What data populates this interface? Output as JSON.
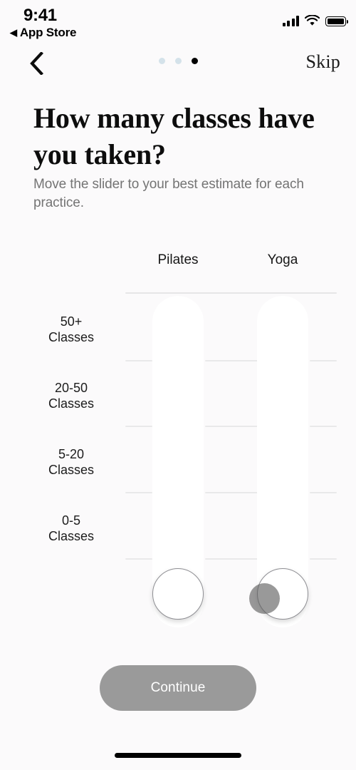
{
  "status_bar": {
    "time": "9:41",
    "return_app": "App Store",
    "return_arrow": "◀",
    "signal_icon": "cellular-signal-icon",
    "wifi_icon": "wifi-icon",
    "battery_icon": "battery-full-icon"
  },
  "nav": {
    "back_icon": "chevron-left-icon",
    "skip_label": "Skip",
    "dots": [
      {
        "active": false
      },
      {
        "active": false
      },
      {
        "active": true
      }
    ]
  },
  "content": {
    "headline": "How many classes have you taken?",
    "subtitle": "Move the slider to your best estimate for each practice."
  },
  "slider_chart": {
    "columns": [
      {
        "label": "Pilates",
        "value_index": 0,
        "value_label": "0-5 Classes"
      },
      {
        "label": "Yoga",
        "value_index": 0,
        "value_label": "0-5 Classes"
      }
    ],
    "axis_labels": [
      {
        "line1": "50+",
        "line2": "Classes"
      },
      {
        "line1": "20-50",
        "line2": "Classes"
      },
      {
        "line1": "5-20",
        "line2": "Classes"
      },
      {
        "line1": "0-5",
        "line2": "Classes"
      }
    ],
    "touch_cursor": "touch-indicator"
  },
  "footer": {
    "continue_label": "Continue"
  },
  "colors": {
    "background": "#fbfafb",
    "track": "#ffffff",
    "gridline": "#e9e9ea",
    "active_dot": "#000000",
    "inactive_dot": "#d4e2ea",
    "button": "#9a9a9a",
    "button_text": "#ffffff",
    "subtitle_text": "#747474"
  }
}
